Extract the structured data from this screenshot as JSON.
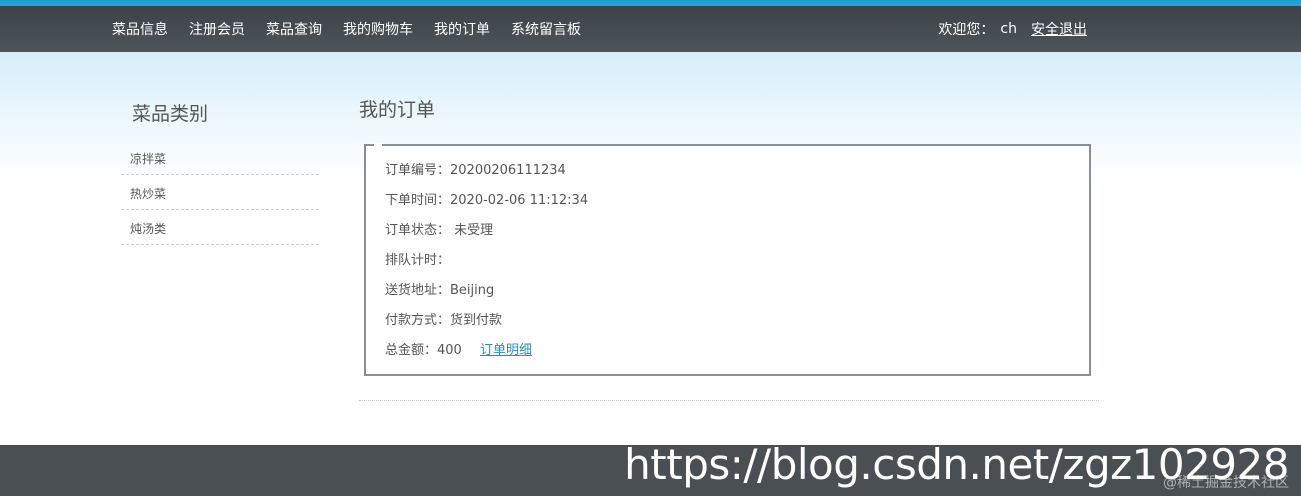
{
  "nav": {
    "links": [
      "菜品信息",
      "注册会员",
      "菜品查询",
      "我的购物车",
      "我的订单",
      "系统留言板"
    ],
    "welcome": "欢迎您：",
    "username": "ch",
    "logout": "安全退出"
  },
  "sidebar": {
    "title": "菜品类别",
    "items": [
      "凉拌菜",
      "热炒菜",
      "炖汤类"
    ]
  },
  "main": {
    "title": "我的订单",
    "order": {
      "number_label": "订单编号：",
      "number": "20200206111234",
      "time_label": "下单时间：",
      "time": "2020-02-06 11:12:34",
      "status_label": "订单状态：",
      "status": " 未受理",
      "queue_label": "排队计时：",
      "queue": "",
      "address_label": "送货地址：",
      "address": "Beijing",
      "payment_label": "付款方式：",
      "payment": "货到付款",
      "total_label": "总金额：",
      "total": "400",
      "detail_link": "订单明细"
    }
  },
  "watermark": {
    "url": "https://blog.csdn.net/zgz102928",
    "sub": "@稀土掘金技术社区"
  },
  "colors": {
    "nav_bg": "#474d52",
    "top_strip": "#1a9fd0",
    "link": "#2a8fbd",
    "footer_bg": "#4a4f53"
  }
}
